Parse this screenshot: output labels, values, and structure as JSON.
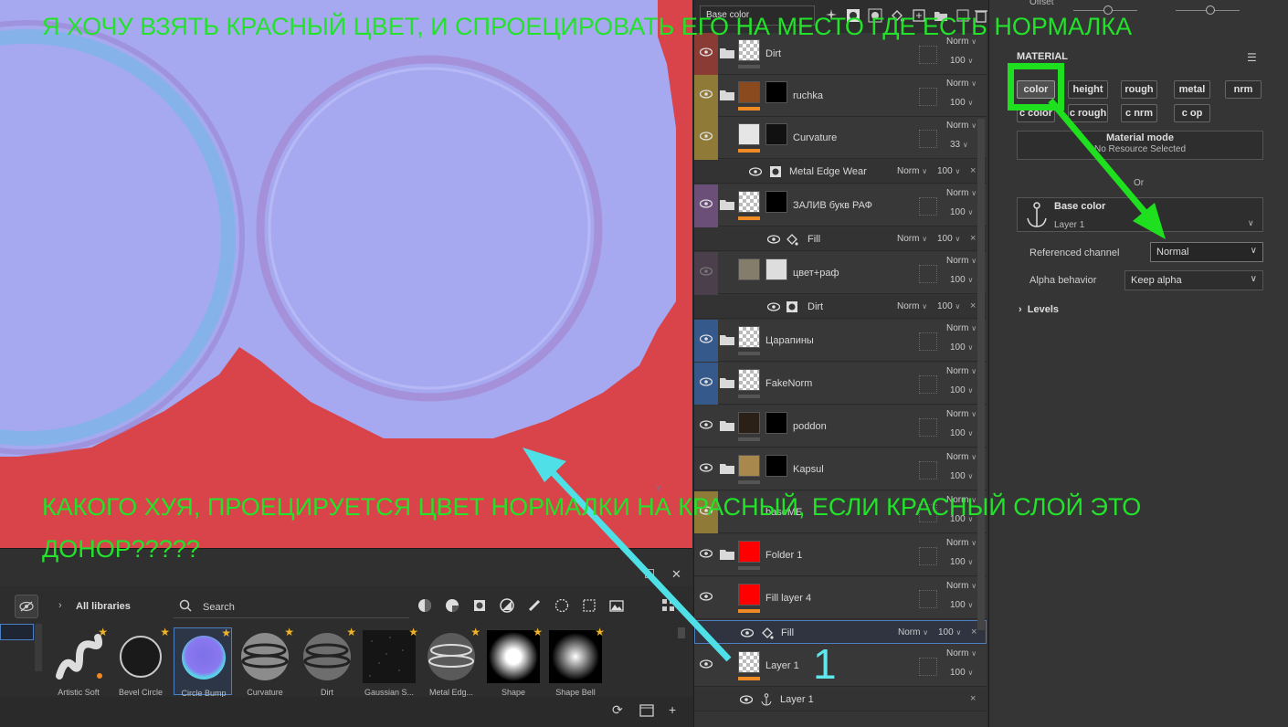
{
  "annotations": {
    "top_text": "Я ХОЧУ ВЗЯТЬ КРАСНЫЙ ЦВЕТ, И СПРОЕЦИРОВАТЬ ЕГО НА МЕСТО ГДЕ ЕСТЬ НОРМАЛКА",
    "bottom_text_line1": "КАКОГО ХУЯ, ПРОЕЦИРУЕТСЯ ЦВЕТ НОРМАЛКИ НА КРАСНЫЙ, ЕСЛИ КРАСНЫЙ СЛОЙ ЭТО",
    "bottom_text_line2": "ДОНОР?????",
    "number_label": "1",
    "colors": {
      "green": "#22e22a",
      "cyan": "#5ee8ee"
    }
  },
  "viewport": {
    "axis_label": "Y"
  },
  "shelf": {
    "library_title": "All libraries",
    "search_placeholder": "Search",
    "thumbnails": [
      {
        "label": "Artistic Soft",
        "icon": "squiggle-brush"
      },
      {
        "label": "Bevel Circle",
        "icon": "ring"
      },
      {
        "label": "Circle Bump",
        "icon": "bump-disc"
      },
      {
        "label": "Curvature",
        "icon": "metal-sphere"
      },
      {
        "label": "Dirt",
        "icon": "dirt-sphere"
      },
      {
        "label": "Gaussian S...",
        "icon": "noise"
      },
      {
        "label": "Metal Edg...",
        "icon": "metal-edge-sphere"
      },
      {
        "label": "Shape",
        "icon": "soft-disc"
      },
      {
        "label": "Shape Bell",
        "icon": "bell-disc"
      }
    ]
  },
  "layers_panel": {
    "channel": "Base color",
    "layers": [
      {
        "name": "Dirt",
        "blend": "Norm",
        "opacity": "100"
      },
      {
        "name": "ruchka",
        "blend": "Norm",
        "opacity": "100"
      },
      {
        "name": "Curvature",
        "blend": "Norm",
        "opacity": "33"
      },
      {
        "name": "ЗАЛИВ букв РАФ",
        "blend": "Norm",
        "opacity": "100"
      },
      {
        "name": "цвет+раф",
        "blend": "Norm",
        "opacity": "100"
      },
      {
        "name": "Царапины",
        "blend": "Norm",
        "opacity": "100"
      },
      {
        "name": "FakeNorm",
        "blend": "Norm",
        "opacity": "100"
      },
      {
        "name": "poddon",
        "blend": "Norm",
        "opacity": "100"
      },
      {
        "name": "Kapsul",
        "blend": "Norm",
        "opacity": "100"
      },
      {
        "name": "baseME",
        "blend": "Norm",
        "opacity": "100"
      },
      {
        "name": "Folder 1",
        "blend": "Norm",
        "opacity": "100"
      },
      {
        "name": "Fill layer 4",
        "blend": "Norm",
        "opacity": "100"
      },
      {
        "name": "Layer 1",
        "blend": "Norm",
        "opacity": "100"
      }
    ],
    "effects": [
      {
        "name": "Metal Edge Wear",
        "blend": "Norm",
        "opacity": "100"
      },
      {
        "name": "Fill",
        "blend": "Norm",
        "opacity": "100"
      },
      {
        "name": "Dirt",
        "blend": "Norm",
        "opacity": "100"
      },
      {
        "name": "Fill",
        "blend": "Norm",
        "opacity": "100"
      },
      {
        "name": "Layer 1",
        "blend": "",
        "opacity": ""
      }
    ]
  },
  "properties": {
    "offset_label": "Offset",
    "material_title": "MATERIAL",
    "channel_buttons": [
      "color",
      "height",
      "rough",
      "metal",
      "nrm",
      "c color",
      "c rough",
      "c nrm",
      "c op"
    ],
    "material_mode_title": "Material mode",
    "material_mode_sub": "No Resource Selected",
    "or_label": "Or",
    "base_color_title": "Base color",
    "base_color_sub": "Layer 1",
    "referenced_channel_label": "Referenced channel",
    "referenced_channel_value": "Normal",
    "alpha_behavior_label": "Alpha behavior",
    "alpha_behavior_value": "Keep alpha",
    "levels_label": "Levels"
  }
}
